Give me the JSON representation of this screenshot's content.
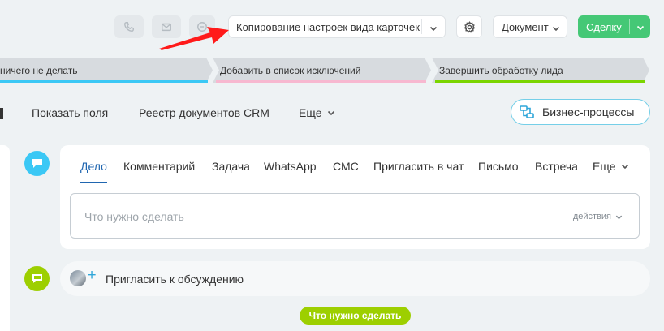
{
  "toolbar": {
    "phone_icon": "phone-icon",
    "mail_icon": "mail-icon",
    "chat_icon": "chat-icon",
    "copy_settings_label": "Копирование настроек вида карточек",
    "settings_icon": "gear-icon",
    "document_label": "Документ",
    "deal_label": "Сделку"
  },
  "stages": [
    {
      "label": "ничего не делать",
      "color": "#3bc8f5"
    },
    {
      "label": "Добавить в список исключений",
      "color": "#f7b8d0"
    },
    {
      "label": "Завершить обработку лида",
      "color": "#7bd500"
    }
  ],
  "nav": {
    "show_fields": "Показать поля",
    "crm_registry": "Реестр документов CRM",
    "more": "Еще",
    "business_processes": "Бизнес-процессы"
  },
  "activity": {
    "tabs": [
      "Дело",
      "Комментарий",
      "Задача",
      "WhatsApp",
      "СМС",
      "Пригласить в чат",
      "Письмо",
      "Встреча"
    ],
    "more_tab": "Еще",
    "active_tab": "Дело",
    "placeholder": "Что нужно сделать",
    "actions_label": "действия"
  },
  "invite": {
    "label": "Пригласить к обсуждению"
  },
  "badge": {
    "label": "Что нужно сделать"
  },
  "colors": {
    "accent": "#2066b0",
    "success": "#45c876",
    "timeline_blue": "#3bc8f5",
    "timeline_green": "#9dcf00",
    "annotation_arrow": "#ff1a1a"
  }
}
